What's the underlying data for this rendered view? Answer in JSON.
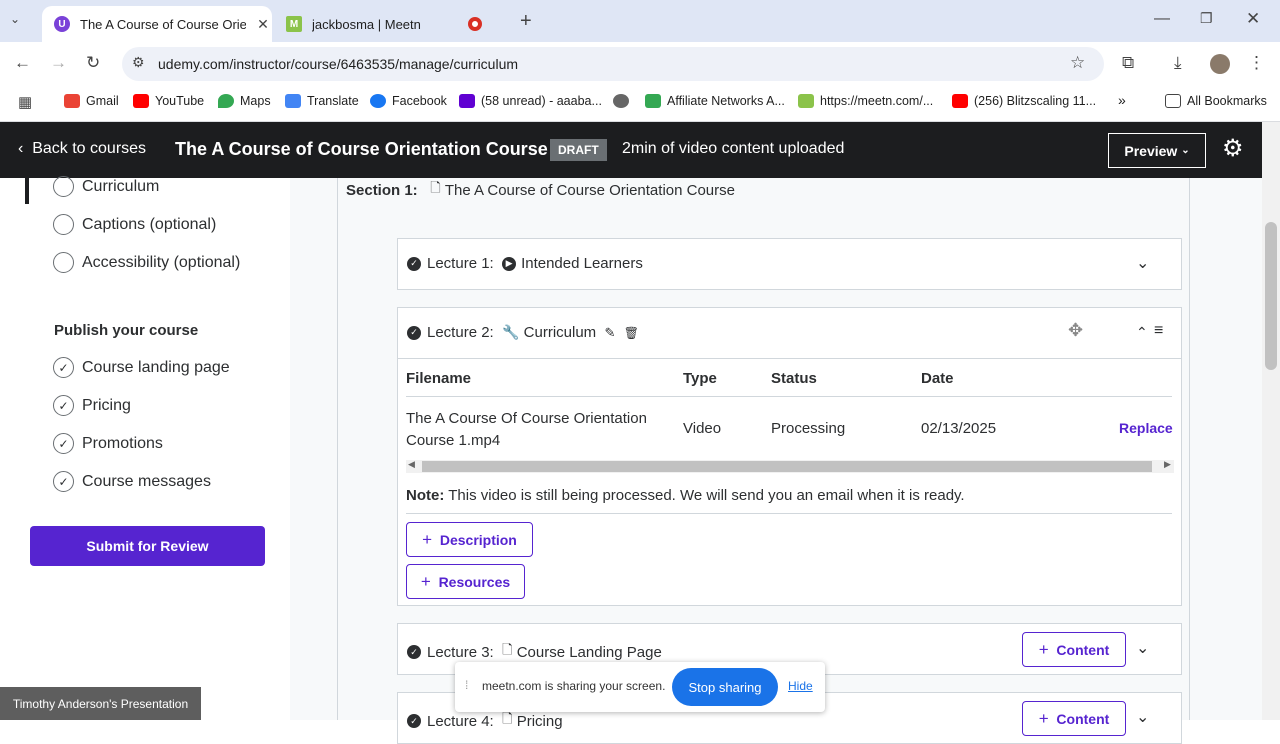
{
  "browser": {
    "tabs": [
      {
        "title": "The A Course of Course Orienta",
        "favicon": "udemy-icon"
      },
      {
        "title": "jackbosma | Meetn",
        "favicon": "meetn-icon"
      }
    ],
    "url": "udemy.com/instructor/course/6463535/manage/curriculum",
    "bookmarks": [
      "Gmail",
      "YouTube",
      "Maps",
      "Translate",
      "Facebook",
      "(58 unread) - aaaba...",
      "Affiliate Networks A...",
      "https://meetn.com/...",
      "(256) Blitzscaling 11..."
    ],
    "all_bookmarks": "All Bookmarks",
    "overflow": "»"
  },
  "header": {
    "back_label": "Back to courses",
    "course_title": "The A Course of Course Orientation Course",
    "status_badge": "DRAFT",
    "upload_status": "2min of video content uploaded",
    "preview_label": "Preview"
  },
  "sidebar": {
    "plan_items": [
      {
        "label": "Curriculum"
      },
      {
        "label": "Captions (optional)"
      },
      {
        "label": "Accessibility (optional)"
      }
    ],
    "publish_heading": "Publish your course",
    "publish_items": [
      {
        "label": "Course landing page"
      },
      {
        "label": "Pricing"
      },
      {
        "label": "Promotions"
      },
      {
        "label": "Course messages"
      }
    ],
    "submit_label": "Submit for Review"
  },
  "section": {
    "label": "Section 1:",
    "title": "The A Course of Course Orientation Course"
  },
  "lectures": [
    {
      "label": "Lecture 1:",
      "title": "Intended Learners"
    },
    {
      "label": "Lecture 2:",
      "title": "Curriculum"
    },
    {
      "label": "Lecture 3:",
      "title": "Course Landing Page",
      "content_btn": "Content"
    },
    {
      "label": "Lecture 4:",
      "title": "Pricing",
      "content_btn": "Content"
    }
  ],
  "file_table": {
    "headers": [
      "Filename",
      "Type",
      "Status",
      "Date"
    ],
    "row": {
      "filename": "The A Course Of Course Orientation Course 1.mp4",
      "type": "Video",
      "status": "Processing",
      "date": "02/13/2025",
      "action": "Replace"
    }
  },
  "note": {
    "label": "Note:",
    "text": "This video is still being processed. We will send you an email when it is ready."
  },
  "lecture_buttons": {
    "description": "Description",
    "resources": "Resources"
  },
  "screen_share": {
    "message": "meetn.com is sharing your screen.",
    "stop": "Stop sharing",
    "hide": "Hide"
  },
  "presenter": "Timothy Anderson's Presentation",
  "colors": {
    "accent": "#5624d0",
    "header_bg": "#1c1d1f",
    "share_blue": "#1a73e8"
  }
}
